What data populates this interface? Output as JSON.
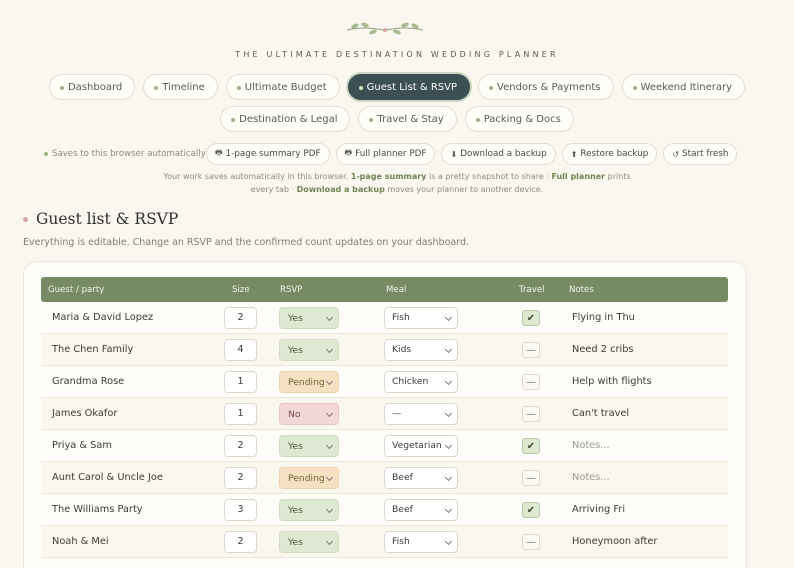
{
  "brand": "THE ULTIMATE DESTINATION WEDDING PLANNER",
  "nav_row1": [
    "Dashboard",
    "Timeline",
    "Ultimate Budget",
    "Guest List & RSVP",
    "Vendors & Payments",
    "Weekend Itinerary"
  ],
  "nav_row2": [
    "Destination & Legal",
    "Travel & Stay",
    "Packing & Docs"
  ],
  "active_tab": "Guest List & RSVP",
  "save_note": "Saves to this browser automatically",
  "actions": [
    {
      "icon": "printer-icon",
      "glyph": "🖶",
      "label": "1-page summary PDF"
    },
    {
      "icon": "printer-icon",
      "glyph": "🖶",
      "label": "Full planner PDF"
    },
    {
      "icon": "download-icon",
      "glyph": "⬇",
      "label": "Download a backup"
    },
    {
      "icon": "upload-icon",
      "glyph": "⬆",
      "label": "Restore backup"
    },
    {
      "icon": "refresh-icon",
      "glyph": "↺",
      "label": "Start fresh"
    }
  ],
  "help": {
    "p1": "Your work saves automatically in this browser. ",
    "b1": "1-page summary",
    "p2": " is a pretty snapshot to share · ",
    "b2": "Full planner",
    "p3": " prints",
    "p4": "every tab · ",
    "b3": "Download a backup",
    "p5": " moves your planner to another device."
  },
  "section": {
    "title": "Guest list & RSVP",
    "subtitle": "Everything is editable. Change an RSVP and the confirmed count updates on your dashboard."
  },
  "columns": {
    "guest": "Guest / party",
    "size": "Size",
    "rsvp": "RSVP",
    "meal": "Meal",
    "travel": "Travel",
    "notes": "Notes"
  },
  "rows": [
    {
      "name": "Maria & David Lopez",
      "size": "2",
      "rsvp": "Yes",
      "meal": "Fish",
      "travel": "✔",
      "travel_on": true,
      "notes": "Flying in Thu",
      "placeholder": false
    },
    {
      "name": "The Chen Family",
      "size": "4",
      "rsvp": "Yes",
      "meal": "Kids",
      "travel": "—",
      "travel_on": false,
      "notes": "Need 2 cribs",
      "placeholder": false
    },
    {
      "name": "Grandma Rose",
      "size": "1",
      "rsvp": "Pending",
      "meal": "Chicken",
      "travel": "—",
      "travel_on": false,
      "notes": "Help with flights",
      "placeholder": false
    },
    {
      "name": "James Okafor",
      "size": "1",
      "rsvp": "No",
      "meal": "—",
      "travel": "—",
      "travel_on": false,
      "notes": "Can't travel",
      "placeholder": false
    },
    {
      "name": "Priya & Sam",
      "size": "2",
      "rsvp": "Yes",
      "meal": "Vegetarian",
      "travel": "✔",
      "travel_on": true,
      "notes": "Notes...",
      "placeholder": true
    },
    {
      "name": "Aunt Carol & Uncle Joe",
      "size": "2",
      "rsvp": "Pending",
      "meal": "Beef",
      "travel": "—",
      "travel_on": false,
      "notes": "Notes...",
      "placeholder": true
    },
    {
      "name": "The Williams Party",
      "size": "3",
      "rsvp": "Yes",
      "meal": "Beef",
      "travel": "✔",
      "travel_on": true,
      "notes": "Arriving Fri",
      "placeholder": false
    },
    {
      "name": "Noah & Mei",
      "size": "2",
      "rsvp": "Yes",
      "meal": "Fish",
      "travel": "—",
      "travel_on": false,
      "notes": "Honeymoon after",
      "placeholder": false
    }
  ],
  "colors": {
    "sage": "#768a63",
    "active_tab": "#3c4f53",
    "cream": "#faf7f0"
  }
}
